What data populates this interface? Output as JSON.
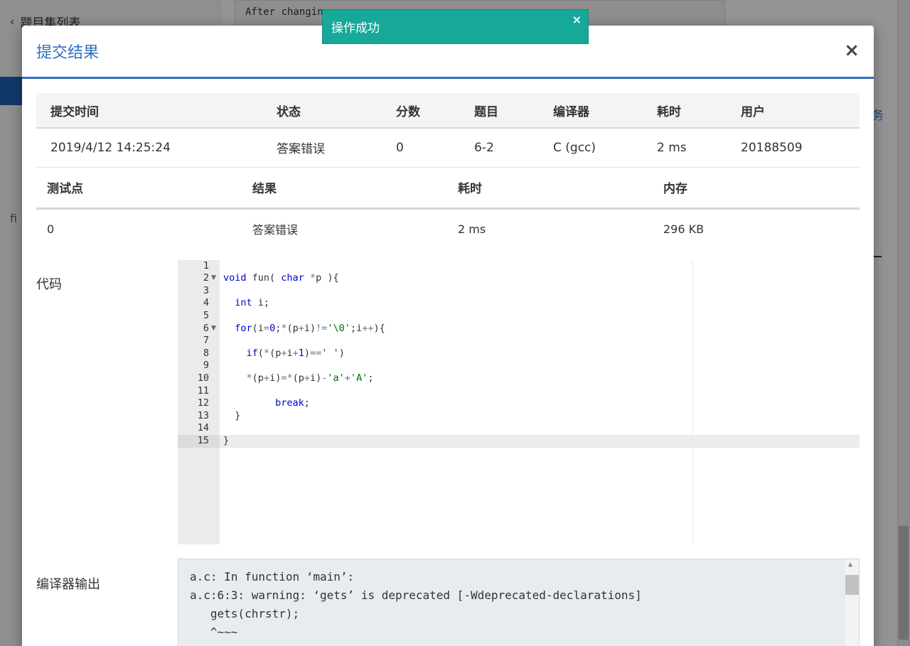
{
  "background": {
    "back_link": "题目集列表",
    "code_snippet": "After changin",
    "left_text": "fi"
  },
  "toast": {
    "message": "操作成功",
    "close": "×"
  },
  "modal": {
    "title": "提交结果",
    "close": "×",
    "submission": {
      "headers": [
        "提交时间",
        "状态",
        "分数",
        "题目",
        "编译器",
        "耗时",
        "用户"
      ],
      "row": {
        "time": "2019/4/12 14:25:24",
        "status": "答案错误",
        "score": "0",
        "problem": "6-2",
        "compiler": "C (gcc)",
        "duration": "2 ms",
        "user": "20188509"
      }
    },
    "cases": {
      "headers": [
        "测试点",
        "结果",
        "耗时",
        "内存"
      ],
      "rows": [
        {
          "case": "0",
          "result": "答案错误",
          "duration": "2 ms",
          "memory": "296 KB"
        }
      ]
    },
    "code_label": "代码",
    "code_lines": [
      "",
      "void fun( char *p ){",
      "",
      "  int i;",
      "",
      "  for(i=0;*(p+i)!='\\0';i++){",
      "",
      "    if(*(p+i+1)==' ')",
      "",
      "    *(p+i)=*(p+i)-'a'+'A';",
      "",
      "         break;",
      "  }",
      "",
      "}"
    ],
    "compiler_output_label": "编译器输出",
    "compiler_output": [
      "a.c: In function ‘main’:",
      "a.c:6:3: warning: ‘gets’ is deprecated [-Wdeprecated-declarations]",
      "   gets(chrstr);",
      "   ^~~~"
    ]
  },
  "colors": {
    "accent": "#2f6fc0",
    "status_wrong": "#3aa853",
    "toast": "#16a99a"
  }
}
